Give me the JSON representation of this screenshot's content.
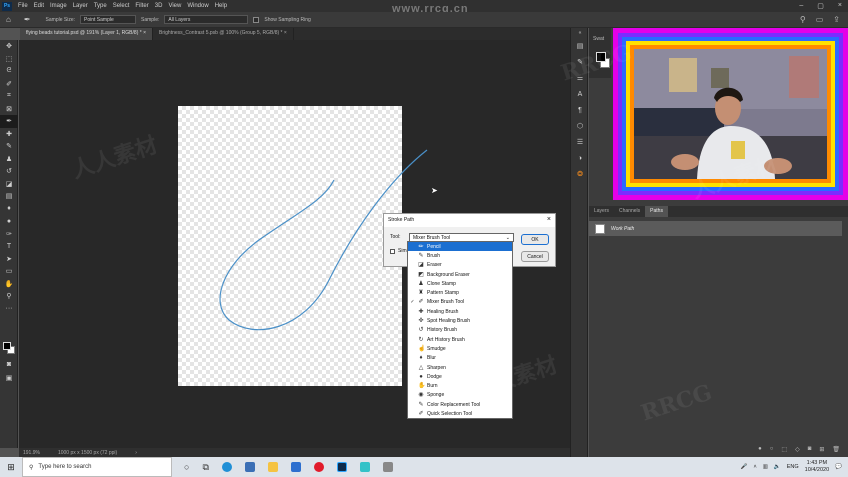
{
  "app": {
    "logo": "Ps",
    "menu": [
      "File",
      "Edit",
      "Image",
      "Layer",
      "Type",
      "Select",
      "Filter",
      "3D",
      "View",
      "Window",
      "Help"
    ],
    "watermark_top": "www.rrcg.cn"
  },
  "options": {
    "sample_size_label": "Sample Size:",
    "sample_size_value": "Point Sample",
    "sample_label": "Sample:",
    "sample_value": "All Layers",
    "show_ring_label": "Show Sampling Ring"
  },
  "tabs": [
    {
      "label": "flying beads tutorial.psd @ 191% (Layer 1, RGB/8) *",
      "close": "×"
    },
    {
      "label": "Brightness_Contrast 5.psb @ 100% (Group 5, RGB/8) *",
      "close": "×"
    }
  ],
  "status": {
    "zoom": "191.9%",
    "doc_info": "1000 px x 1500 px (72 ppi)"
  },
  "swatches_label": "Swat",
  "panels": {
    "tabs": [
      "Layers",
      "Channels",
      "Paths"
    ],
    "active_tab": "Paths",
    "path_name": "Work Path"
  },
  "dialog": {
    "title": "Stroke Path",
    "close": "×",
    "tool_label": "Tool:",
    "tool_value": "Mixer Brush Tool",
    "simulate_label": "Sim",
    "ok": "OK",
    "cancel": "Cancel"
  },
  "dropdown": {
    "items": [
      {
        "label": "Pencil",
        "icon": "✏",
        "checked": false,
        "highlighted": true
      },
      {
        "label": "Brush",
        "icon": "✎",
        "checked": false,
        "highlighted": false
      },
      {
        "label": "Eraser",
        "icon": "◪",
        "checked": false,
        "highlighted": false
      },
      {
        "label": "Background Eraser",
        "icon": "◩",
        "checked": false,
        "highlighted": false
      },
      {
        "label": "Clone Stamp",
        "icon": "♟",
        "checked": false,
        "highlighted": false
      },
      {
        "label": "Pattern Stamp",
        "icon": "♜",
        "checked": false,
        "highlighted": false
      },
      {
        "label": "Mixer Brush Tool",
        "icon": "✐",
        "checked": true,
        "highlighted": false
      },
      {
        "label": "Healing Brush",
        "icon": "✚",
        "checked": false,
        "highlighted": false
      },
      {
        "label": "Spot Healing Brush",
        "icon": "✜",
        "checked": false,
        "highlighted": false
      },
      {
        "label": "History Brush",
        "icon": "↺",
        "checked": false,
        "highlighted": false
      },
      {
        "label": "Art History Brush",
        "icon": "↻",
        "checked": false,
        "highlighted": false
      },
      {
        "label": "Smudge",
        "icon": "☝",
        "checked": false,
        "highlighted": false
      },
      {
        "label": "Blur",
        "icon": "♦",
        "checked": false,
        "highlighted": false
      },
      {
        "label": "Sharpen",
        "icon": "△",
        "checked": false,
        "highlighted": false
      },
      {
        "label": "Dodge",
        "icon": "●",
        "checked": false,
        "highlighted": false
      },
      {
        "label": "Burn",
        "icon": "✋",
        "checked": false,
        "highlighted": false
      },
      {
        "label": "Sponge",
        "icon": "◉",
        "checked": false,
        "highlighted": false
      },
      {
        "label": "Color Replacement Tool",
        "icon": "✎",
        "checked": false,
        "highlighted": false
      },
      {
        "label": "Quick Selection Tool",
        "icon": "✐",
        "checked": false,
        "highlighted": false
      }
    ]
  },
  "taskbar": {
    "search_placeholder": "Type here to search",
    "tray_lang": "ENG",
    "time": "1:43 PM",
    "date": "10/4/2020"
  },
  "colors": {
    "path_stroke": "#4a90c8",
    "highlight": "#1b6fd1"
  },
  "watermarks": [
    "人人素材",
    "RRCG"
  ]
}
